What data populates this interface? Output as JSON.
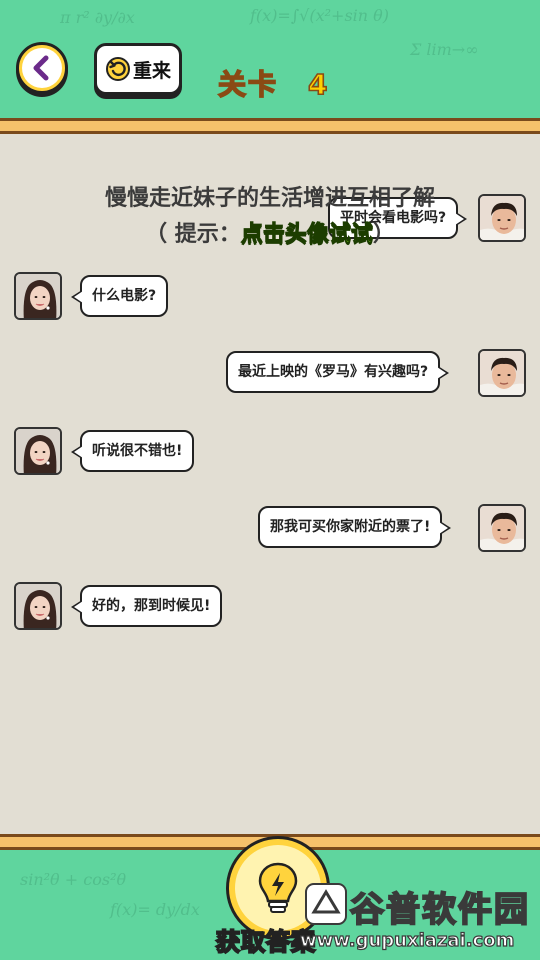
{
  "header": {
    "retry_label": "重来",
    "level_prefix": "关卡",
    "level_number": "4"
  },
  "puzzle": {
    "title": "慢慢走近妹子的生活增进互相了解",
    "hint_open": "（ 提示：",
    "hint_highlight": "点击头像试试",
    "hint_close": "）"
  },
  "messages": [
    {
      "side": "right",
      "speaker": "boy",
      "text": "平时会看电影吗?"
    },
    {
      "side": "left",
      "speaker": "girl",
      "text": "什么电影?"
    },
    {
      "side": "right",
      "speaker": "boy",
      "text": "最近上映的《罗马》有兴趣吗?"
    },
    {
      "side": "left",
      "speaker": "girl",
      "text": "听说很不错也!"
    },
    {
      "side": "right",
      "speaker": "boy",
      "text": "那我可买你家附近的票了!"
    },
    {
      "side": "left",
      "speaker": "girl",
      "text": "好的，那到时候见!"
    }
  ],
  "footer": {
    "answer_label": "获取答案"
  },
  "watermark": {
    "title": "谷普软件园",
    "url": "www.gupuxiazai.com"
  },
  "colors": {
    "header_bg": "#5fd59e",
    "border_orange": "#f6c16b",
    "chat_bg": "#e2ded3",
    "button_yellow": "#ffd33d",
    "level_text": "#ffd000",
    "hint_green": "#8cf21a"
  },
  "icons": {
    "back": "chevron-left-icon",
    "retry": "refresh-icon",
    "answer": "lightbulb-icon"
  }
}
